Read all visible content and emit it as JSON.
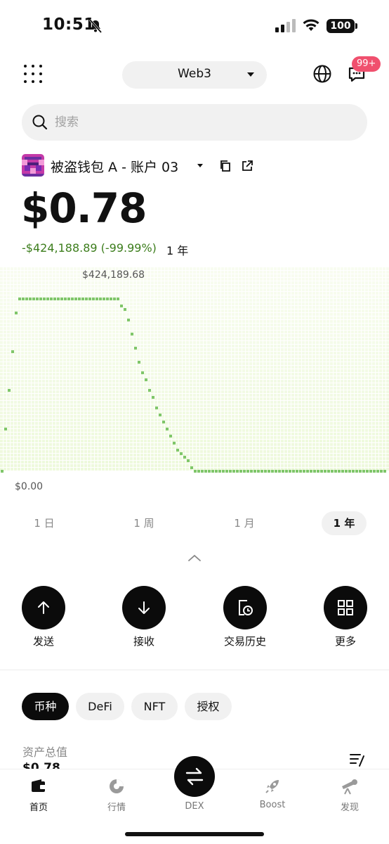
{
  "status_bar": {
    "time": "10:51",
    "battery": "100"
  },
  "header": {
    "network": "Web3",
    "notifications_badge": "99+"
  },
  "search": {
    "placeholder": "搜索"
  },
  "account": {
    "name": "被盗钱包 A - 账户 03",
    "balance": "$0.78",
    "change": "-$424,188.89 (-99.99%)",
    "change_period": "1 年"
  },
  "chart_data": {
    "type": "line",
    "max_label": "$424,189.68",
    "min_label": "$0.00",
    "ylim": [
      0,
      424189.68
    ],
    "color": "#7fc66a",
    "x": [
      0,
      0.04,
      0.06,
      0.3,
      0.32,
      0.34,
      0.36,
      0.4,
      0.45,
      0.5,
      0.55,
      1.0
    ],
    "values": [
      0,
      424189.68,
      424189.68,
      424189.68,
      395000,
      330000,
      250000,
      160000,
      60000,
      0,
      0,
      0
    ]
  },
  "range_tabs": [
    "1 日",
    "1 周",
    "1 月",
    "1 年"
  ],
  "actions": [
    "发送",
    "接收",
    "交易历史",
    "更多"
  ],
  "asset_tabs": [
    "币种",
    "DeFi",
    "NFT",
    "授权"
  ],
  "assets": {
    "total_label": "资产总值",
    "total_value": "$0.78"
  },
  "bottom_nav": [
    "首页",
    "行情",
    "DEX",
    "Boost",
    "发现"
  ],
  "colors": {
    "accent": "#0b0b0b",
    "positive_change": "#3c7d1c",
    "badge": "#f0506e",
    "chart_line": "#7fc66a"
  }
}
